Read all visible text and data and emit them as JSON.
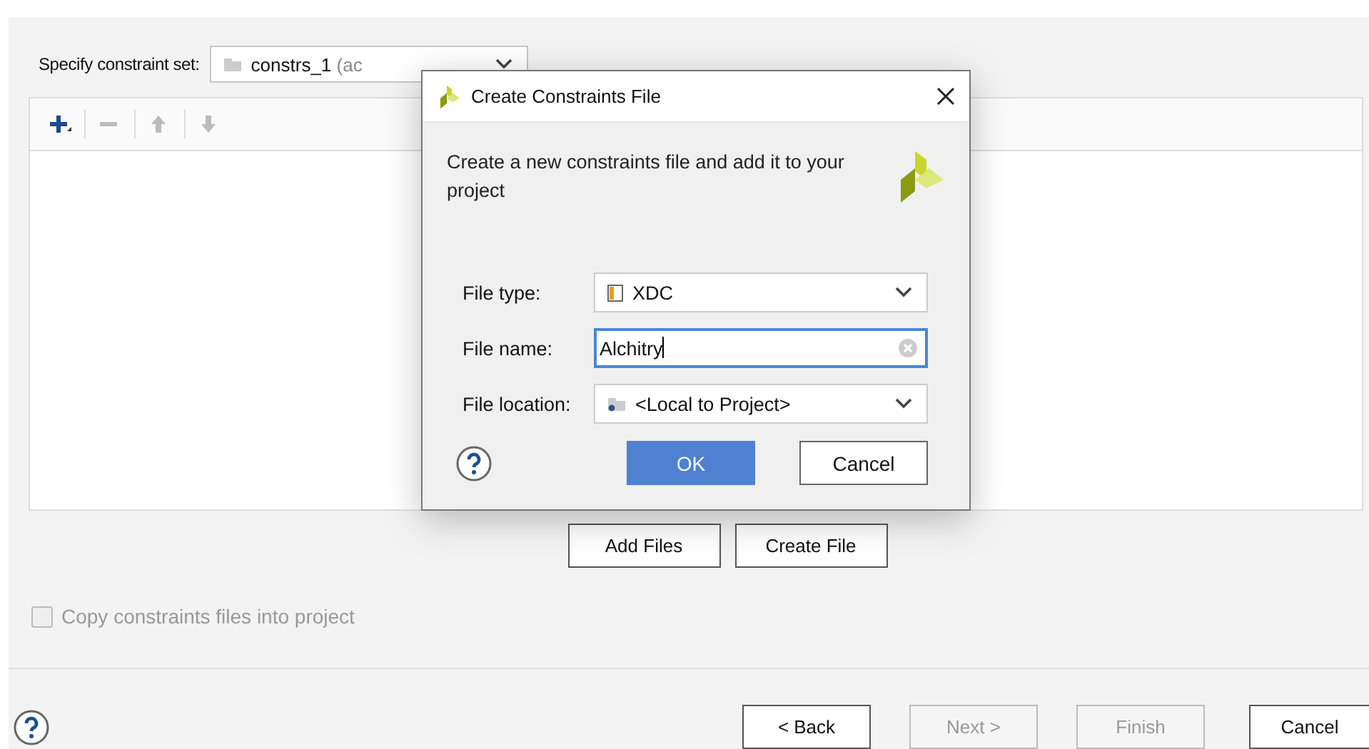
{
  "wizard": {
    "constraint_set_label": "Specify constraint set:",
    "constraint_set_value": "constrs_1 (ac",
    "toolbar": [
      {
        "kind": "add",
        "disabled": false
      },
      {
        "kind": "remove",
        "disabled": true
      },
      {
        "kind": "up",
        "disabled": true
      },
      {
        "kind": "down",
        "disabled": true
      }
    ],
    "file_buttons": [
      "Add Files",
      "Create File"
    ],
    "copy_checkbox": {
      "label": "Copy constraints files into project",
      "checked": false,
      "disabled": true
    },
    "nav_buttons": [
      {
        "label": "< Back",
        "disabled": false
      },
      {
        "label": "Next >",
        "disabled": true
      },
      {
        "label": "Finish",
        "disabled": true
      },
      {
        "label": "Cancel",
        "disabled": false
      }
    ]
  },
  "dialog": {
    "title": "Create Constraints File",
    "description": "Create a new constraints file and add it to your project",
    "fields": [
      {
        "kind": "select",
        "label": "File type:",
        "value": "XDC"
      },
      {
        "kind": "input",
        "label": "File name:",
        "value": "Alchitry"
      },
      {
        "kind": "select",
        "label": "File location:",
        "value": "<Local to Project>"
      }
    ],
    "buttons": [
      {
        "label": "OK",
        "primary": true
      },
      {
        "label": "Cancel",
        "primary": false
      }
    ]
  }
}
